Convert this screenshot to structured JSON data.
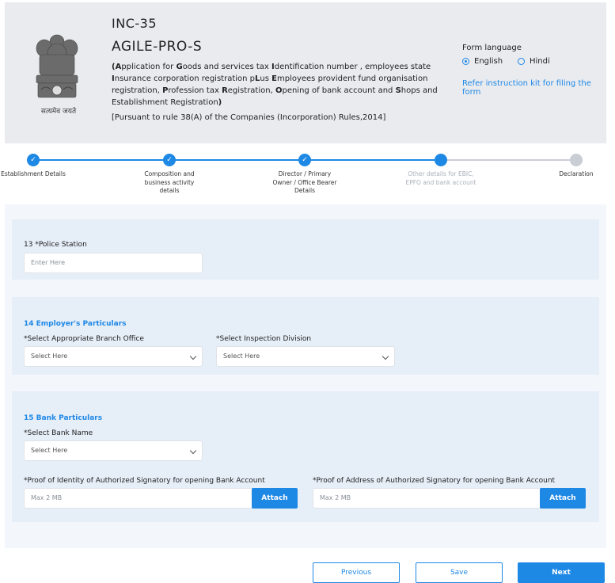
{
  "header": {
    "form_code": "INC-35",
    "form_title": "AGILE-PRO-S",
    "description_parts": [
      {
        "t": "(",
        "b": true
      },
      {
        "t": "A",
        "b": true
      },
      {
        "t": "pplication for ",
        "b": false
      },
      {
        "t": "G",
        "b": true
      },
      {
        "t": "oods and services tax ",
        "b": false
      },
      {
        "t": "I",
        "b": true
      },
      {
        "t": "dentification number , employees state ",
        "b": false
      },
      {
        "t": "I",
        "b": true
      },
      {
        "t": "nsurance corporation registration p",
        "b": false
      },
      {
        "t": "L",
        "b": true
      },
      {
        "t": "us ",
        "b": false
      },
      {
        "t": "E",
        "b": true
      },
      {
        "t": "mployees provident fund organisation registration, ",
        "b": false
      },
      {
        "t": "P",
        "b": true
      },
      {
        "t": "rofession tax ",
        "b": false
      },
      {
        "t": "R",
        "b": true
      },
      {
        "t": "egistration, ",
        "b": false
      },
      {
        "t": "O",
        "b": true
      },
      {
        "t": "pening of bank account and ",
        "b": false
      },
      {
        "t": "S",
        "b": true
      },
      {
        "t": "hops and Establishment Registration",
        "b": false
      },
      {
        "t": ")",
        "b": true
      }
    ],
    "pursuant": "[Pursuant to rule 38(A) of the Companies (Incorporation) Rules,2014]",
    "emblem_motto": "सत्यमेव जयते",
    "form_language_label": "Form language",
    "languages": [
      {
        "label": "English",
        "selected": true
      },
      {
        "label": "Hindi",
        "selected": false
      }
    ],
    "instruction_link": "Refer instruction kit for filing the form"
  },
  "stepper": {
    "steps": [
      {
        "label": "Establishment Details",
        "state": "done"
      },
      {
        "label": "Composition and business activity details",
        "state": "done"
      },
      {
        "label": "Director / Primary Owner / Office Bearer Details",
        "state": "done"
      },
      {
        "label": "Other details for EBIC, EPFO and bank account",
        "state": "active"
      },
      {
        "label": "Declaration",
        "state": "todo"
      }
    ],
    "check_glyph": "✓"
  },
  "police": {
    "label": "13 *Police Station",
    "placeholder": "Enter Here"
  },
  "employer": {
    "title": "14 Employer's Particulars",
    "branch_label": "*Select Appropriate Branch Office",
    "branch_value": "Select Here",
    "division_label": "*Select Inspection Division",
    "division_value": "Select Here"
  },
  "bank": {
    "title": "15 Bank Particulars",
    "bank_label": "*Select Bank Name",
    "bank_value": "Select Here",
    "identity_label": "*Proof of Identity of Authorized Signatory for opening Bank Account",
    "identity_placeholder": "Max 2 MB",
    "address_label": "*Proof of Address of Authorized Signatory for opening Bank Account",
    "address_placeholder": "Max 2 MB",
    "attach_label": "Attach"
  },
  "footer": {
    "previous_label": "Previous",
    "save_label": "Save",
    "next_label": "Next"
  },
  "colors": {
    "accent": "#1e88e5",
    "header_bg": "#e9ebef",
    "panel_bg": "#e6eef8",
    "pending": "#c9cdd4"
  }
}
